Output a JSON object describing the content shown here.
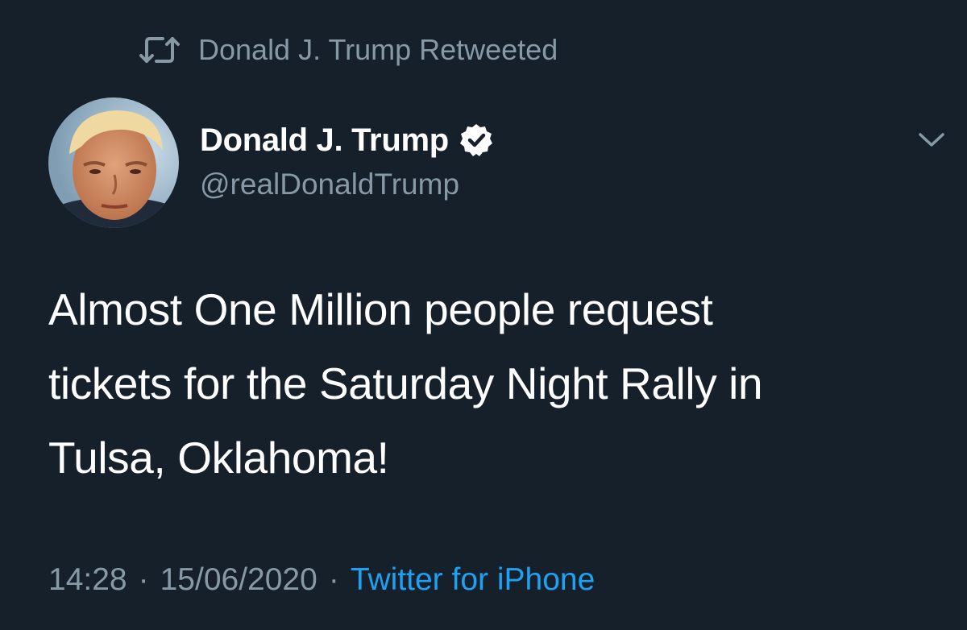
{
  "retweet_banner": {
    "icon": "retweet-icon",
    "text": "Donald J. Trump Retweeted"
  },
  "author": {
    "avatar": "avatar",
    "display_name": "Donald J. Trump",
    "verified_icon": "verified-badge-icon",
    "handle": "@realDonaldTrump"
  },
  "menu": {
    "icon": "chevron-down-icon"
  },
  "tweet": {
    "lines": [
      "Almost One Million people request",
      "tickets for the Saturday Night Rally in",
      "Tulsa, Oklahoma!"
    ]
  },
  "meta": {
    "time": "14:28",
    "separator": "·",
    "date": "15/06/2020",
    "source": "Twitter for iPhone"
  },
  "colors": {
    "background": "#15202b",
    "primary_text": "#ffffff",
    "secondary_text": "#8899a6",
    "link": "#1da1f2"
  }
}
